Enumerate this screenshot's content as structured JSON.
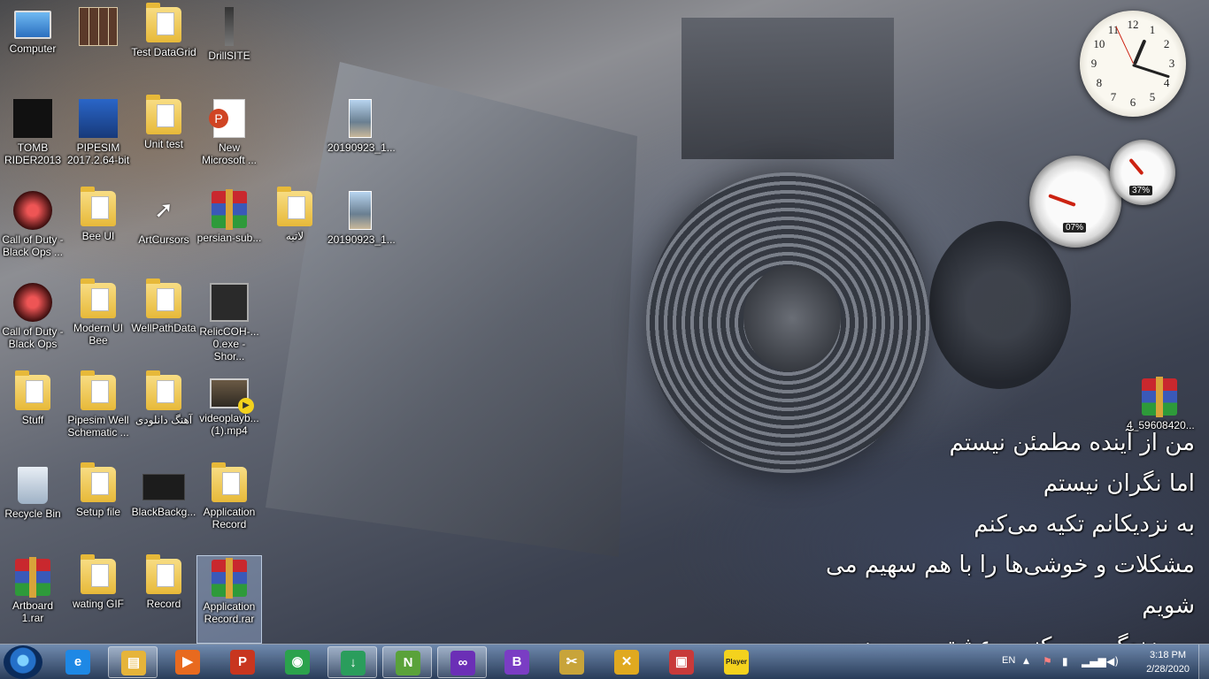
{
  "desktop_icons": [
    {
      "label": "Computer",
      "icon": "computer-icon"
    },
    {
      "label": "",
      "icon": "sudoku-grid-icon"
    },
    {
      "label": "Test DataGrid",
      "icon": "folder-icon"
    },
    {
      "label": "DrillSITE",
      "icon": "drill-tower-icon"
    },
    {
      "label": "TOMB\nRIDER2013",
      "icon": "tomb-raider-icon"
    },
    {
      "label": "PIPESIM\n2017.2.64-bit",
      "icon": "pipesim-icon"
    },
    {
      "label": "Unit test",
      "icon": "folder-icon"
    },
    {
      "label": "New\nMicrosoft ...",
      "icon": "powerpoint-icon"
    },
    {
      "label": "20190923_1...",
      "icon": "photo-icon"
    },
    {
      "label": "Call of Duty -\nBlack Ops ...",
      "icon": "call-of-duty-icon"
    },
    {
      "label": "Bee UI",
      "icon": "folder-icon"
    },
    {
      "label": "ArtCursors",
      "icon": "cursor-icon"
    },
    {
      "label": "persian-sub...",
      "icon": "winrar-icon"
    },
    {
      "label": "لاتیه",
      "icon": "folder-icon"
    },
    {
      "label": "20190923_1...",
      "icon": "photo-icon"
    },
    {
      "label": "Call of Duty -\nBlack Ops",
      "icon": "call-of-duty-icon"
    },
    {
      "label": "Modern UI\nBee",
      "icon": "folder-icon"
    },
    {
      "label": "WellPathData",
      "icon": "folder-icon"
    },
    {
      "label": "RelicCOH-...\n0.exe - Shor...",
      "icon": "company-of-heroes-icon"
    },
    {
      "label": "Stuff",
      "icon": "folder-icon"
    },
    {
      "label": "Pipesim Well\nSchematic ...",
      "icon": "folder-icon"
    },
    {
      "label": "آهنگ دانلودی",
      "icon": "folder-icon"
    },
    {
      "label": "videoplayb...\n(1).mp4",
      "icon": "video-file-icon"
    },
    {
      "label": "Recycle Bin",
      "icon": "recycle-bin-icon"
    },
    {
      "label": "Setup file",
      "icon": "folder-icon"
    },
    {
      "label": "BlackBackg...",
      "icon": "black-image-icon"
    },
    {
      "label": "Application\nRecord",
      "icon": "folder-icon"
    },
    {
      "label": "Artboard\n1.rar",
      "icon": "winrar-icon"
    },
    {
      "label": "wating GIF",
      "icon": "folder-icon"
    },
    {
      "label": "Record",
      "icon": "folder-icon"
    },
    {
      "label": "Application\nRecord.rar",
      "icon": "winrar-icon"
    },
    {
      "label": "4_59608420...",
      "icon": "winrar-icon"
    }
  ],
  "gadgets": {
    "clock": {
      "numbers": [
        "12",
        "1",
        "2",
        "3",
        "4",
        "5",
        "6",
        "7",
        "8",
        "9",
        "10",
        "11"
      ]
    },
    "cpu_meter": {
      "cpu_percent": "07%",
      "memory_percent": "37%"
    }
  },
  "poem": {
    "lines": [
      "من از آینده مطمئن نیستم",
      "اما نگران نیستم",
      "به نزدیکانم تکیه می‌کنم",
      "مشکلات و خوشی‌ها را با هم سهیم می شویم",
      "من زندگی می کنم و عشق می ورزم"
    ]
  },
  "taskbar": {
    "pinned": [
      {
        "icon": "internet-explorer-icon",
        "glyph": "e",
        "color": "#1e88e5"
      },
      {
        "icon": "file-explorer-icon",
        "glyph": "▤",
        "color": "#e6b43a"
      },
      {
        "icon": "media-player-icon",
        "glyph": "▶",
        "color": "#e86a1f"
      },
      {
        "icon": "pdf-reader-icon",
        "glyph": "P",
        "color": "#c8361f"
      },
      {
        "icon": "chrome-icon",
        "glyph": "◉",
        "color": "#2ba24c"
      },
      {
        "icon": "download-manager-icon",
        "glyph": "↓",
        "color": "#2a9d5c"
      },
      {
        "icon": "notepad-plus-icon",
        "glyph": "N",
        "color": "#5aa23a"
      },
      {
        "icon": "visual-studio-icon",
        "glyph": "∞",
        "color": "#6b2fb6"
      },
      {
        "icon": "visual-studio-blend-icon",
        "glyph": "B",
        "color": "#7a3dc4"
      },
      {
        "icon": "tools-icon",
        "glyph": "✂",
        "color": "#c8a43a"
      },
      {
        "icon": "network-tool-icon",
        "glyph": "✕",
        "color": "#e0a91f"
      },
      {
        "icon": "installer-icon",
        "glyph": "▣",
        "color": "#c83a3a"
      },
      {
        "icon": "kmplayer-icon",
        "glyph": "Player",
        "color": "#f4d21d"
      }
    ],
    "tray": {
      "language": "EN",
      "time": "3:18 PM",
      "date": "2/28/2020"
    }
  }
}
